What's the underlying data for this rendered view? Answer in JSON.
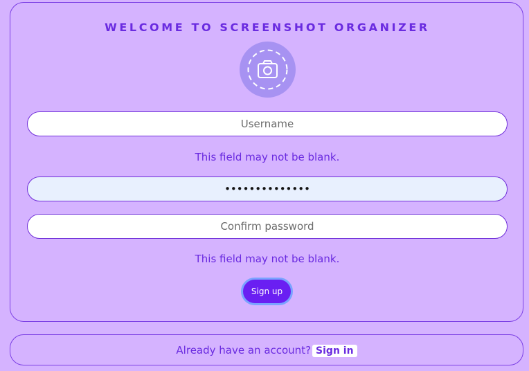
{
  "header": {
    "title": "WELCOME TO SCREENSHOT ORGANIZER"
  },
  "avatar": {
    "icon": "camera-icon"
  },
  "form": {
    "username_placeholder": "Username",
    "username_error": "This field may not be blank.",
    "password_value": "••••••••••••••",
    "confirm_placeholder": "Confirm password",
    "confirm_error": "This field may not be blank.",
    "signup_label": "Sign up"
  },
  "footer": {
    "prompt": "Already have an account?",
    "signin_label": "Sign in"
  },
  "colors": {
    "background": "#d5b3ff",
    "accent": "#6a2be0",
    "button": "#6a1ff2"
  }
}
